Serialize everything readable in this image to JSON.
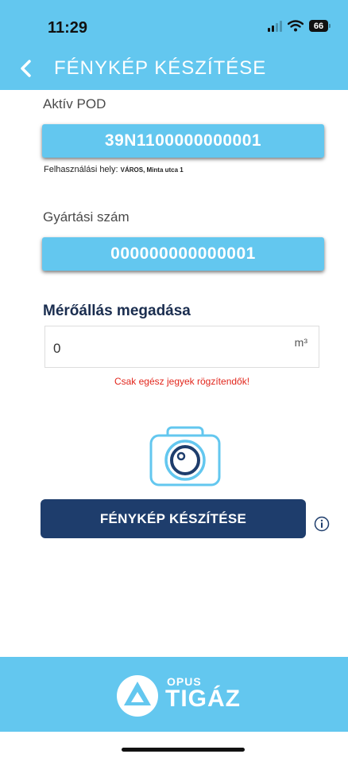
{
  "status_bar": {
    "time": "11:29",
    "battery": "66"
  },
  "header": {
    "title": "FÉNYKÉP KÉSZÍTÉSE"
  },
  "pod": {
    "label": "Aktív POD",
    "value": "39N1100000000001"
  },
  "usage_place": {
    "label": "Felhasználási hely:",
    "value": "VÁROS, Minta utca 1"
  },
  "serial": {
    "label": "Gyártási szám",
    "value": "000000000000001"
  },
  "reading": {
    "heading": "Mérőállás megadása",
    "value": "0",
    "unit": "m³",
    "warning": "Csak egész jegyek rögzítendők!"
  },
  "actions": {
    "photo_button": "FÉNYKÉP KÉSZÍTÉSE"
  },
  "footer": {
    "brand_top": "OPUS",
    "brand_main": "TIGÁZ"
  },
  "colors": {
    "accent": "#63c7ef",
    "primary_button": "#1e3d6c",
    "warning": "#e2261c"
  }
}
